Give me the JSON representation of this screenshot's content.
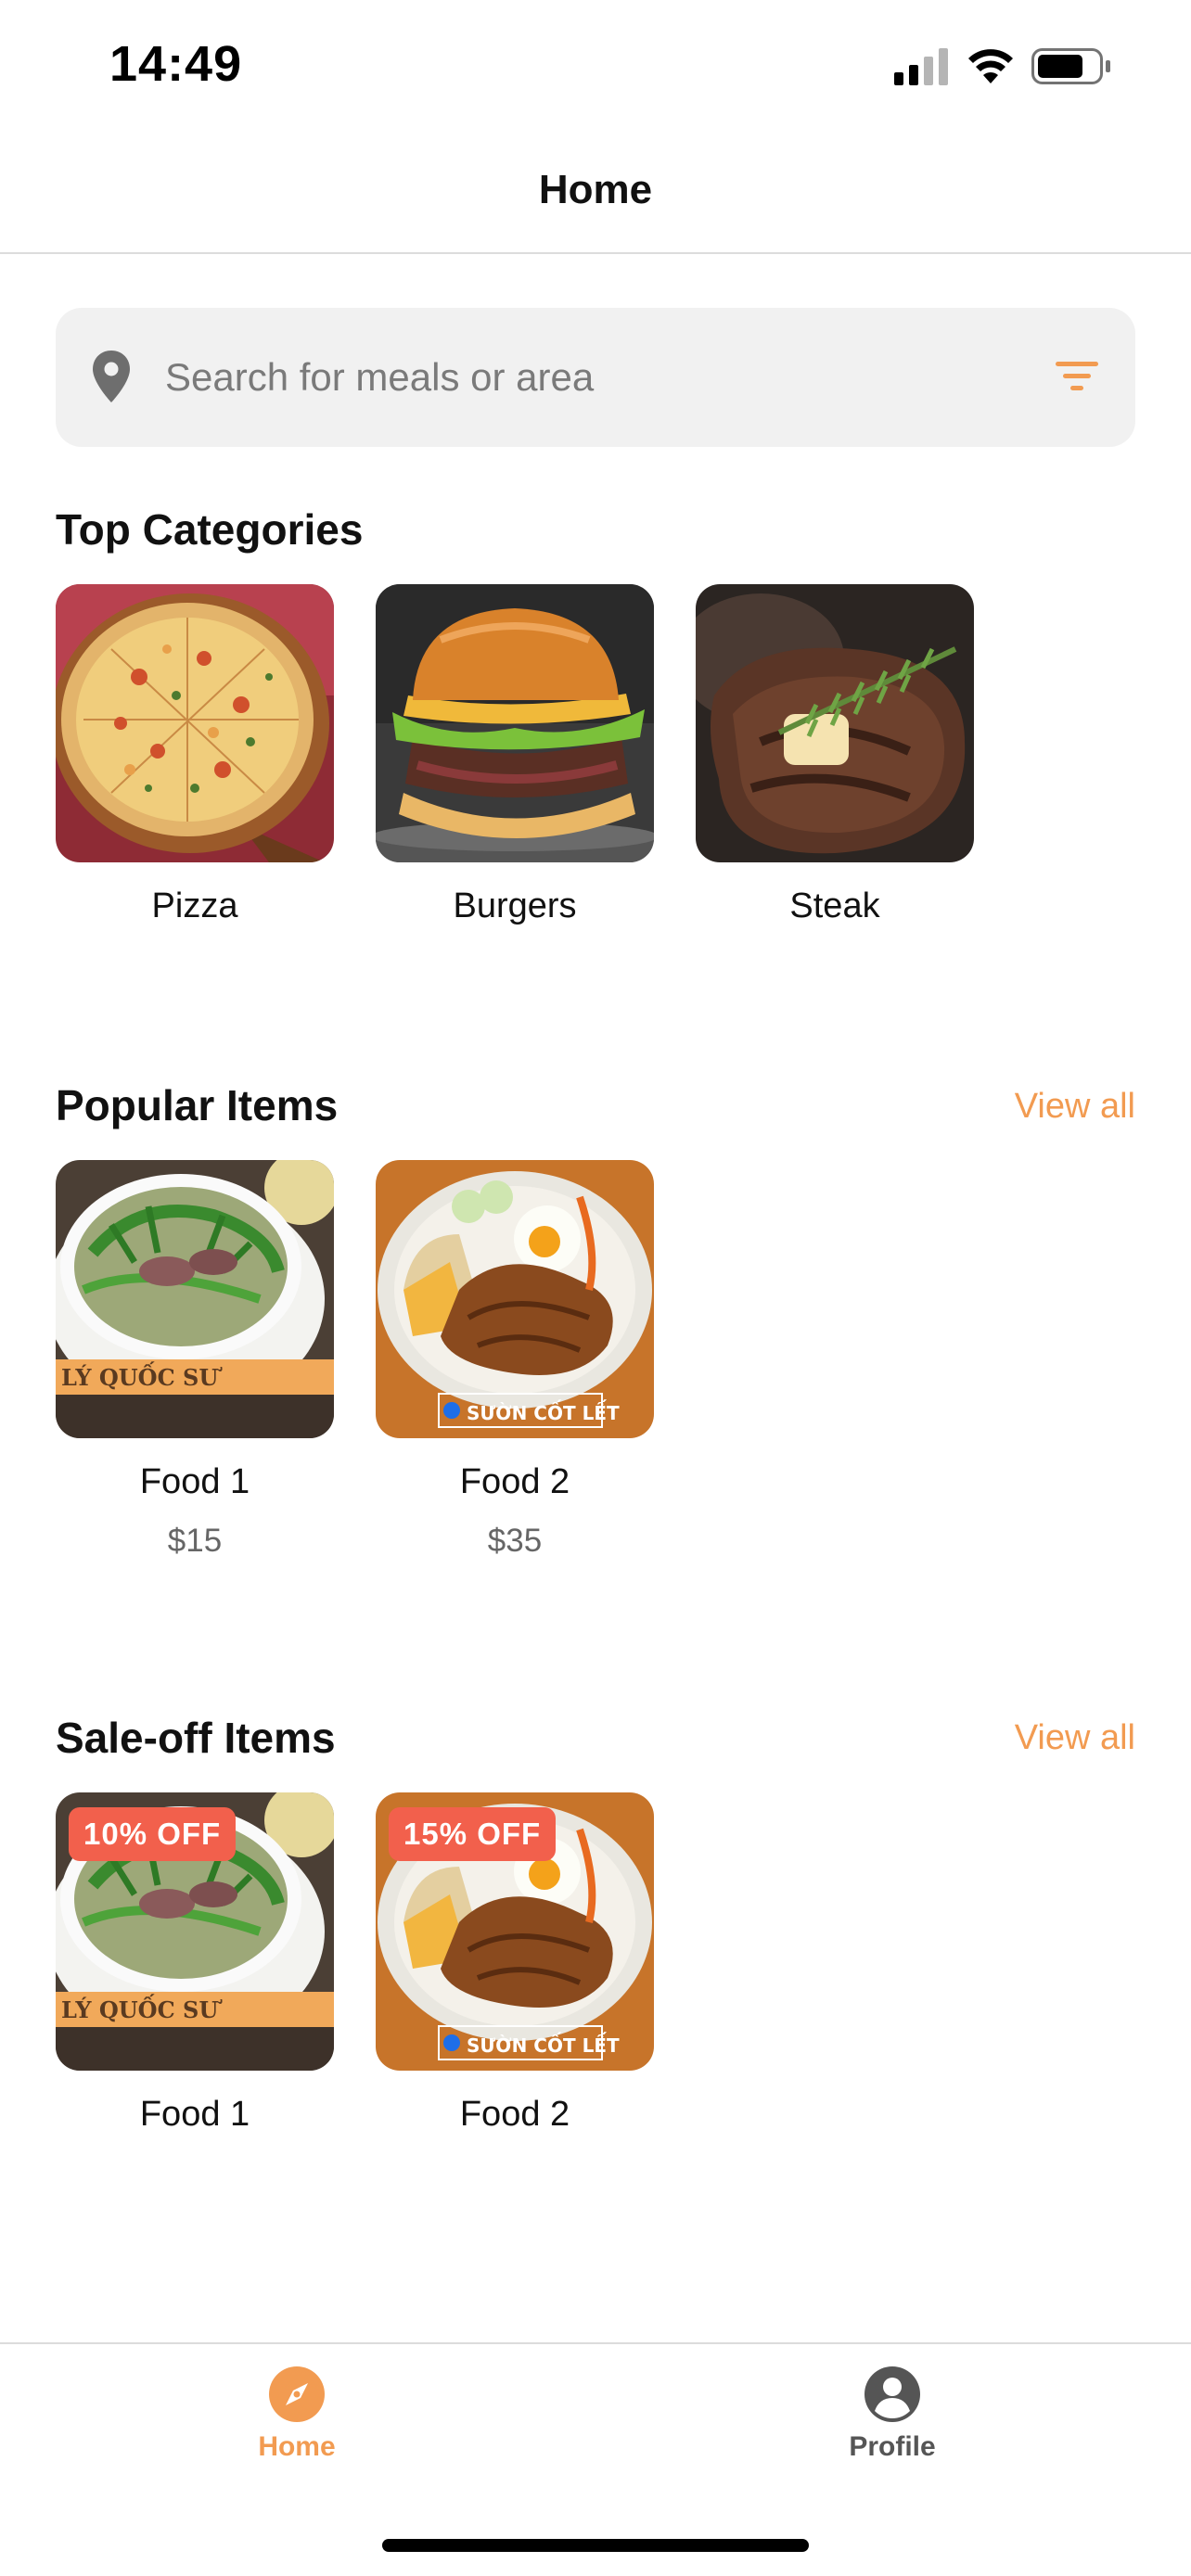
{
  "status_bar": {
    "time": "14:49"
  },
  "header": {
    "title": "Home"
  },
  "search": {
    "placeholder": "Search for meals or area",
    "value": ""
  },
  "top_categories": {
    "title": "Top Categories",
    "items": [
      {
        "label": "Pizza",
        "icon": "pizza-photo"
      },
      {
        "label": "Burgers",
        "icon": "burger-photo"
      },
      {
        "label": "Steak",
        "icon": "steak-photo"
      }
    ]
  },
  "popular_items": {
    "title": "Popular Items",
    "view_all_label": "View all",
    "items": [
      {
        "label": "Food 1",
        "price": "$15",
        "icon": "pho-photo"
      },
      {
        "label": "Food 2",
        "price": "$35",
        "icon": "pork-chop-rice-photo"
      }
    ]
  },
  "sale_items": {
    "title": "Sale-off Items",
    "view_all_label": "View all",
    "items": [
      {
        "label": "Food 1",
        "badge": "10% OFF",
        "icon": "pho-photo"
      },
      {
        "label": "Food 2",
        "badge": "15% OFF",
        "icon": "pork-chop-rice-photo"
      }
    ]
  },
  "tab_bar": {
    "tabs": [
      {
        "label": "Home",
        "icon": "compass-icon",
        "active": true
      },
      {
        "label": "Profile",
        "icon": "user-circle-icon",
        "active": false
      }
    ]
  },
  "colors": {
    "accent": "#f29b51",
    "badge": "#f2604c",
    "inactive": "#555555"
  }
}
